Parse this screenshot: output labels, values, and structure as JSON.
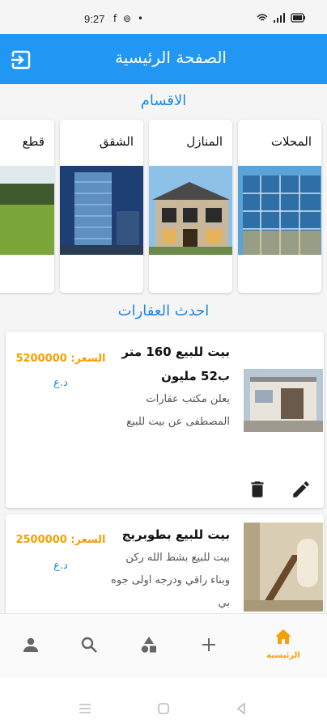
{
  "status_bar": {
    "time": "9:27",
    "app_icons": "f ⊚ •"
  },
  "app_bar": {
    "title": "الصفحة الرئيسية",
    "logout_icon": "logout-icon"
  },
  "sections": {
    "categories_title": "الاقسام",
    "latest_title": "احدث العقارات"
  },
  "categories": [
    {
      "label": "المحلات",
      "image": "glass-office-building"
    },
    {
      "label": "المنازل",
      "image": "modern-house"
    },
    {
      "label": "الشقق",
      "image": "apartment-tower"
    },
    {
      "label": "قطع",
      "image": "land-plot"
    }
  ],
  "properties": [
    {
      "title": "بيت للبيع 160 متر ب52 مليون",
      "description": "يعلن مكتب عقارات المصطفى عن بيت للبيع",
      "price_label": "السعر:",
      "price": "5200000",
      "currency": "د.ع"
    },
    {
      "title": "بيت للبيع بطوبربج",
      "description": "بيت للبيع بشط الله ركن وبناء راقي ودرجه اولى جوه بي",
      "price_label": "السعر:",
      "price": "2500000",
      "currency": "د.ع"
    }
  ],
  "bottom_nav": {
    "home_label": "الرئيسية"
  },
  "colors": {
    "primary": "#2196f3",
    "accent": "#f5a000",
    "section_title": "#1e88e5"
  }
}
